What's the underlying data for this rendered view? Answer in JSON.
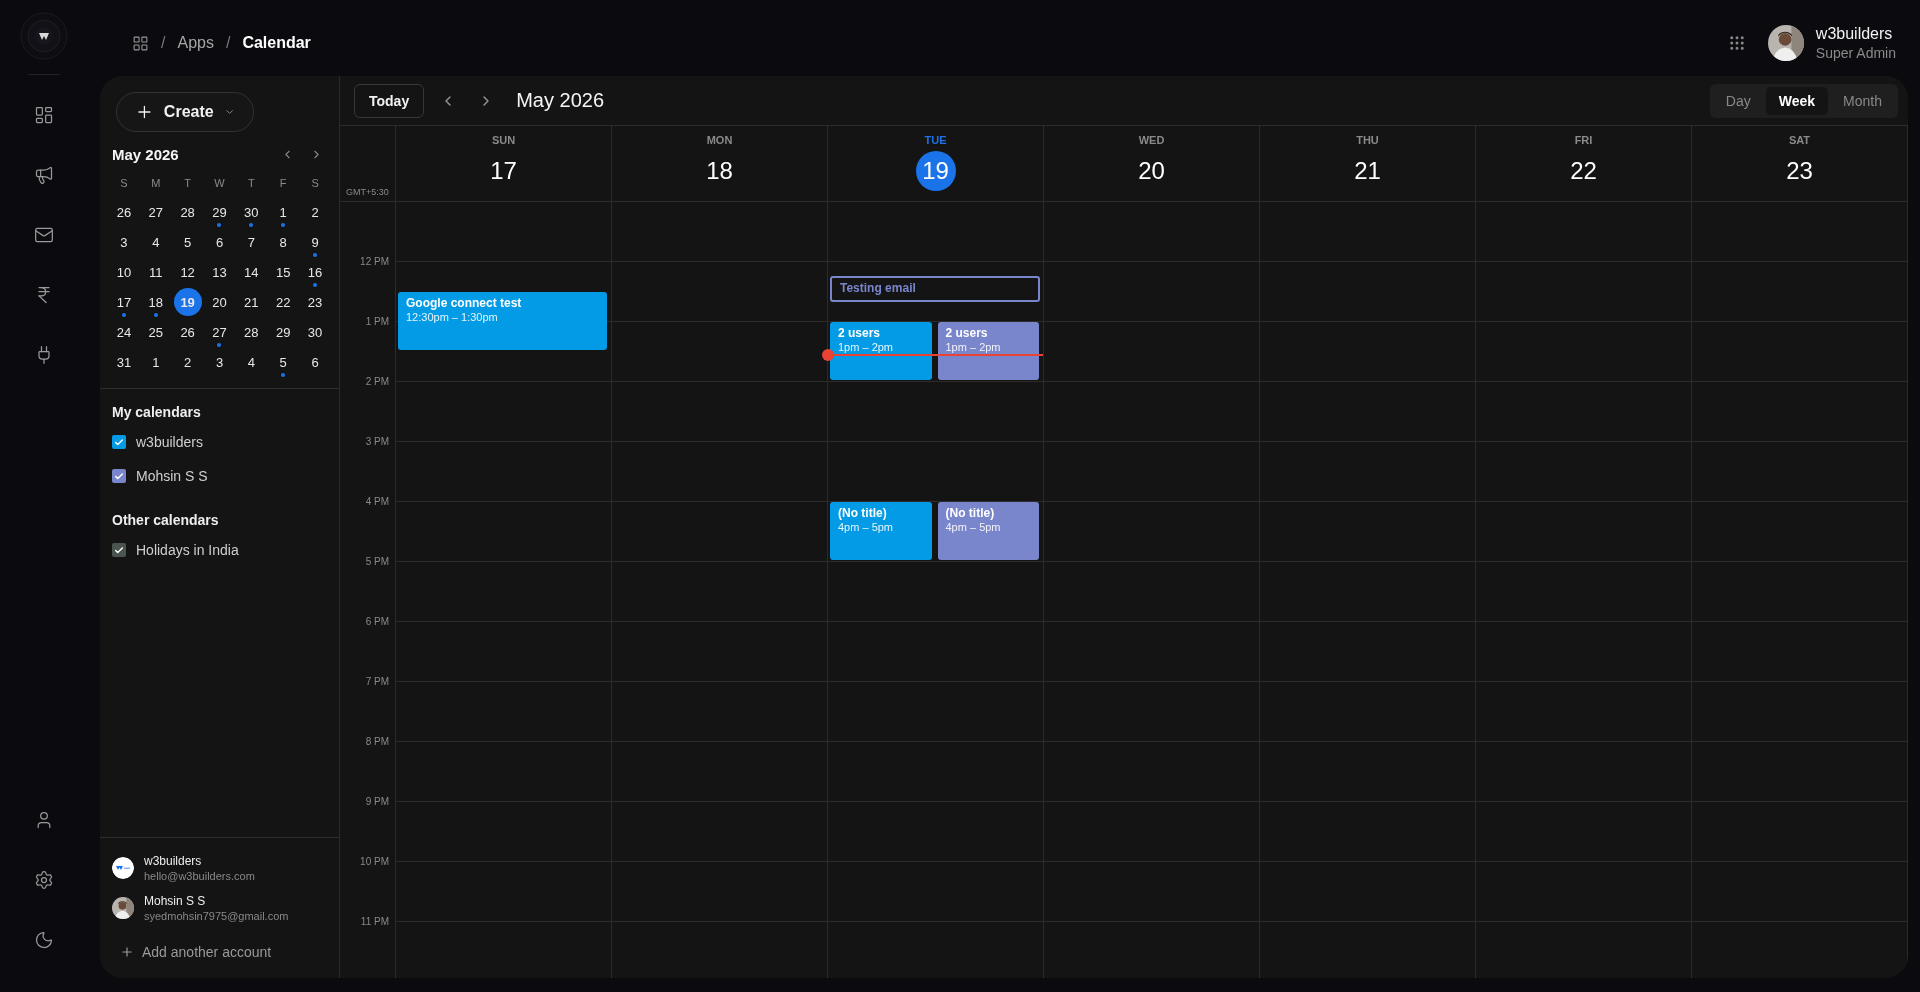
{
  "breadcrumb": [
    {
      "separator": "/",
      "label": "Apps"
    },
    {
      "separator": "/",
      "label": "Calendar"
    }
  ],
  "user": {
    "name": "w3builders",
    "role": "Super Admin"
  },
  "create_button": "Create",
  "mini_calendar": {
    "title": "May 2026",
    "weekdays": [
      "S",
      "M",
      "T",
      "W",
      "T",
      "F",
      "S"
    ],
    "weeks": [
      {
        "days": [
          {
            "label": "26",
            "selected": false,
            "has_event": false
          },
          {
            "label": "27",
            "selected": false,
            "has_event": false
          },
          {
            "label": "28",
            "selected": false,
            "has_event": false
          },
          {
            "label": "29",
            "selected": false,
            "has_event": true
          },
          {
            "label": "30",
            "selected": false,
            "has_event": true
          },
          {
            "label": "1",
            "selected": false,
            "has_event": true
          },
          {
            "label": "2",
            "selected": false,
            "has_event": false
          }
        ]
      },
      {
        "days": [
          {
            "label": "3",
            "selected": false,
            "has_event": false
          },
          {
            "label": "4",
            "selected": false,
            "has_event": false
          },
          {
            "label": "5",
            "selected": false,
            "has_event": false
          },
          {
            "label": "6",
            "selected": false,
            "has_event": false
          },
          {
            "label": "7",
            "selected": false,
            "has_event": false
          },
          {
            "label": "8",
            "selected": false,
            "has_event": false
          },
          {
            "label": "9",
            "selected": false,
            "has_event": true
          }
        ]
      },
      {
        "days": [
          {
            "label": "10",
            "selected": false,
            "has_event": false
          },
          {
            "label": "11",
            "selected": false,
            "has_event": false
          },
          {
            "label": "12",
            "selected": false,
            "has_event": false
          },
          {
            "label": "13",
            "selected": false,
            "has_event": false
          },
          {
            "label": "14",
            "selected": false,
            "has_event": false
          },
          {
            "label": "15",
            "selected": false,
            "has_event": false
          },
          {
            "label": "16",
            "selected": false,
            "has_event": true
          }
        ]
      },
      {
        "days": [
          {
            "label": "17",
            "selected": false,
            "has_event": true
          },
          {
            "label": "18",
            "selected": false,
            "has_event": true
          },
          {
            "label": "19",
            "selected": true,
            "has_event": false
          },
          {
            "label": "20",
            "selected": false,
            "has_event": false
          },
          {
            "label": "21",
            "selected": false,
            "has_event": false
          },
          {
            "label": "22",
            "selected": false,
            "has_event": false
          },
          {
            "label": "23",
            "selected": false,
            "has_event": false
          }
        ]
      },
      {
        "days": [
          {
            "label": "24",
            "selected": false,
            "has_event": false
          },
          {
            "label": "25",
            "selected": false,
            "has_event": false
          },
          {
            "label": "26",
            "selected": false,
            "has_event": false
          },
          {
            "label": "27",
            "selected": false,
            "has_event": true
          },
          {
            "label": "28",
            "selected": false,
            "has_event": false
          },
          {
            "label": "29",
            "selected": false,
            "has_event": false
          },
          {
            "label": "30",
            "selected": false,
            "has_event": false
          }
        ]
      },
      {
        "days": [
          {
            "label": "31",
            "selected": false,
            "has_event": false
          },
          {
            "label": "1",
            "selected": false,
            "has_event": false
          },
          {
            "label": "2",
            "selected": false,
            "has_event": false
          },
          {
            "label": "3",
            "selected": false,
            "has_event": false
          },
          {
            "label": "4",
            "selected": false,
            "has_event": false
          },
          {
            "label": "5",
            "selected": false,
            "has_event": true
          },
          {
            "label": "6",
            "selected": false,
            "has_event": false
          }
        ]
      }
    ]
  },
  "calendar_groups": [
    {
      "title": "My calendars",
      "items": [
        {
          "label": "w3builders",
          "checked": true,
          "color": "#039be5"
        },
        {
          "label": "Mohsin S S",
          "checked": true,
          "color": "#7986cb"
        }
      ]
    },
    {
      "title": "Other calendars",
      "items": [
        {
          "label": "Holidays in India",
          "checked": true,
          "color": "#4b5550"
        }
      ]
    }
  ],
  "accounts": [
    {
      "name": "w3builders",
      "email": "hello@w3builders.com",
      "kind": "logo"
    },
    {
      "name": "Mohsin S S",
      "email": "syedmohsin7975@gmail.com"
    }
  ],
  "add_account": "Add another account",
  "toolbar": {
    "today": "Today",
    "title": "May 2026",
    "views": [
      {
        "label": "Day",
        "selected": false
      },
      {
        "label": "Week",
        "selected": true
      },
      {
        "label": "Month",
        "selected": false
      }
    ]
  },
  "timezone": "GMT+5:30",
  "hours": [
    "12 PM",
    "1 PM",
    "2 PM",
    "3 PM",
    "4 PM",
    "5 PM",
    "6 PM",
    "7 PM",
    "8 PM",
    "9 PM",
    "10 PM",
    "11 PM"
  ],
  "days": [
    {
      "weekday": "SUN",
      "date": "17",
      "selected": false,
      "events": [
        {
          "title": "Google connect test",
          "time": "12:30pm – 1:30pm",
          "color": "#039be5",
          "kind": "filled",
          "now_line": false
        }
      ]
    },
    {
      "weekday": "MON",
      "date": "18",
      "selected": false
    },
    {
      "weekday": "TUE",
      "date": "19",
      "selected": true,
      "events": [
        {
          "title": "Testing email",
          "color": "#7986cb",
          "kind": "outlined"
        },
        {
          "title": "2 users",
          "time": "1pm – 2pm",
          "color": "#039be5",
          "kind": "filled",
          "now_line": true
        },
        {
          "title": "2 users",
          "time": "1pm – 2pm",
          "color": "#7986cb",
          "kind": "filled",
          "now_line": false
        },
        {
          "title": "(No title)",
          "time": "4pm – 5pm",
          "color": "#039be5",
          "kind": "filled",
          "now_line": false
        },
        {
          "title": "(No title)",
          "time": "4pm – 5pm",
          "color": "#7986cb",
          "kind": "filled",
          "now_line": false
        }
      ]
    },
    {
      "weekday": "WED",
      "date": "20",
      "selected": false
    },
    {
      "weekday": "THU",
      "date": "21",
      "selected": false
    },
    {
      "weekday": "FRI",
      "date": "22",
      "selected": false
    },
    {
      "weekday": "SAT",
      "date": "23",
      "selected": false
    }
  ]
}
